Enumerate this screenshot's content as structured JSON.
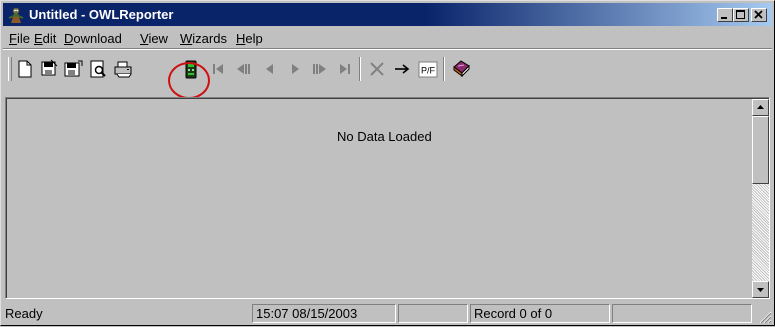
{
  "window": {
    "title": "Untitled - OWLReporter",
    "icon": "owl-app-icon",
    "controls": [
      "minimize-icon",
      "maximize-icon",
      "close-icon"
    ]
  },
  "menu": {
    "file": {
      "accel": "F",
      "rest": "ile"
    },
    "edit": {
      "accel": "E",
      "rest": "dit"
    },
    "download": {
      "accel": "D",
      "rest": "ownload"
    },
    "view": {
      "accel": "V",
      "rest": "iew"
    },
    "wizards": {
      "accel": "W",
      "rest": "izards"
    },
    "help": {
      "accel": "H",
      "rest": "elp"
    }
  },
  "toolbar": {
    "buttons": [
      {
        "name": "new-document-icon",
        "enabled": true
      },
      {
        "name": "open-icon",
        "enabled": true
      },
      {
        "name": "save-icon",
        "enabled": true
      },
      {
        "name": "print-preview-icon",
        "enabled": true
      },
      {
        "name": "print-icon",
        "enabled": true
      },
      {
        "name": "download-device-icon",
        "enabled": true,
        "highlighted": true
      },
      {
        "name": "first-record-icon",
        "enabled": false
      },
      {
        "name": "previous-page-icon",
        "enabled": false
      },
      {
        "name": "previous-record-icon",
        "enabled": false
      },
      {
        "name": "next-record-icon",
        "enabled": false
      },
      {
        "name": "next-page-icon",
        "enabled": false
      },
      {
        "name": "last-record-icon",
        "enabled": false
      },
      {
        "name": "delete-icon",
        "enabled": false
      },
      {
        "name": "goto-arrow-icon",
        "enabled": true
      },
      {
        "name": "pass-fail-icon",
        "enabled": true,
        "label": "P/F"
      },
      {
        "name": "book-icon",
        "enabled": true
      }
    ],
    "highlight_color": "#d01010"
  },
  "main": {
    "message": "No Data Loaded"
  },
  "status": {
    "ready": "Ready",
    "datetime": "15:07  08/15/2003",
    "record": "Record 0 of 0"
  },
  "colors": {
    "title_active": "#0a246a",
    "face": "#c0c0c0"
  }
}
